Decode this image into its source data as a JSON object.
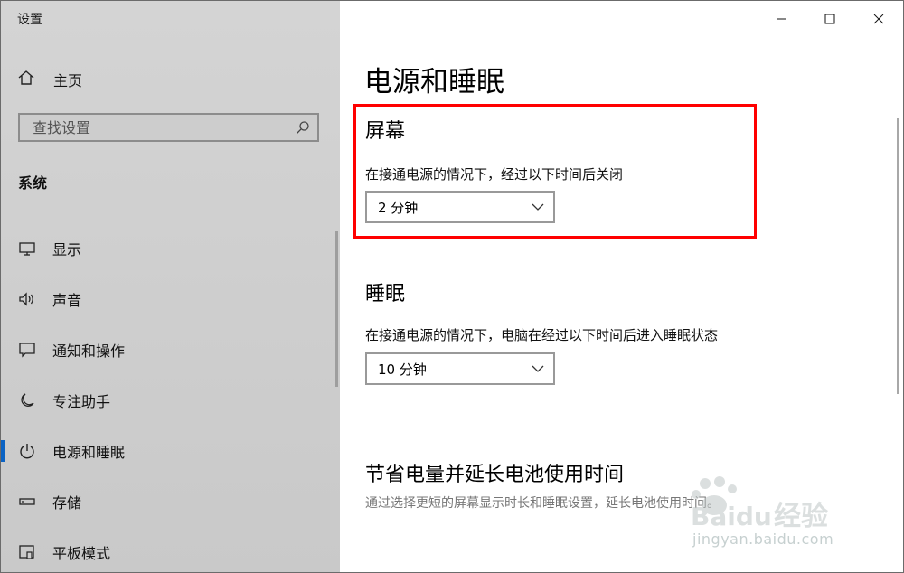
{
  "window": {
    "title": "设置"
  },
  "sidebar": {
    "home_label": "主页",
    "search_placeholder": "查找设置",
    "section_title": "系统",
    "items": [
      {
        "label": "显示",
        "icon": "monitor-icon"
      },
      {
        "label": "声音",
        "icon": "speaker-icon"
      },
      {
        "label": "通知和操作",
        "icon": "notification-icon"
      },
      {
        "label": "专注助手",
        "icon": "moon-icon"
      },
      {
        "label": "电源和睡眠",
        "icon": "power-icon",
        "active": true
      },
      {
        "label": "存储",
        "icon": "storage-icon"
      },
      {
        "label": "平板模式",
        "icon": "tablet-icon"
      }
    ]
  },
  "main": {
    "page_title": "电源和睡眠",
    "screen": {
      "heading": "屏幕",
      "description": "在接通电源的情况下，经过以下时间后关闭",
      "selected": "2 分钟"
    },
    "sleep": {
      "heading": "睡眠",
      "description": "在接通电源的情况下，电脑在经过以下时间后进入睡眠状态",
      "selected": "10 分钟"
    },
    "battery": {
      "heading": "节省电量并延长电池使用时间",
      "description": "通过选择更短的屏幕显示时长和睡眠设置，延长电池使用时间。"
    }
  },
  "watermark": {
    "brand": "Baidu 经验",
    "url": "jingyan.baidu.com"
  },
  "colors": {
    "accent": "#0b63c4",
    "highlight": "#ff0000",
    "sidebar_bg": "#cfcfcf"
  }
}
